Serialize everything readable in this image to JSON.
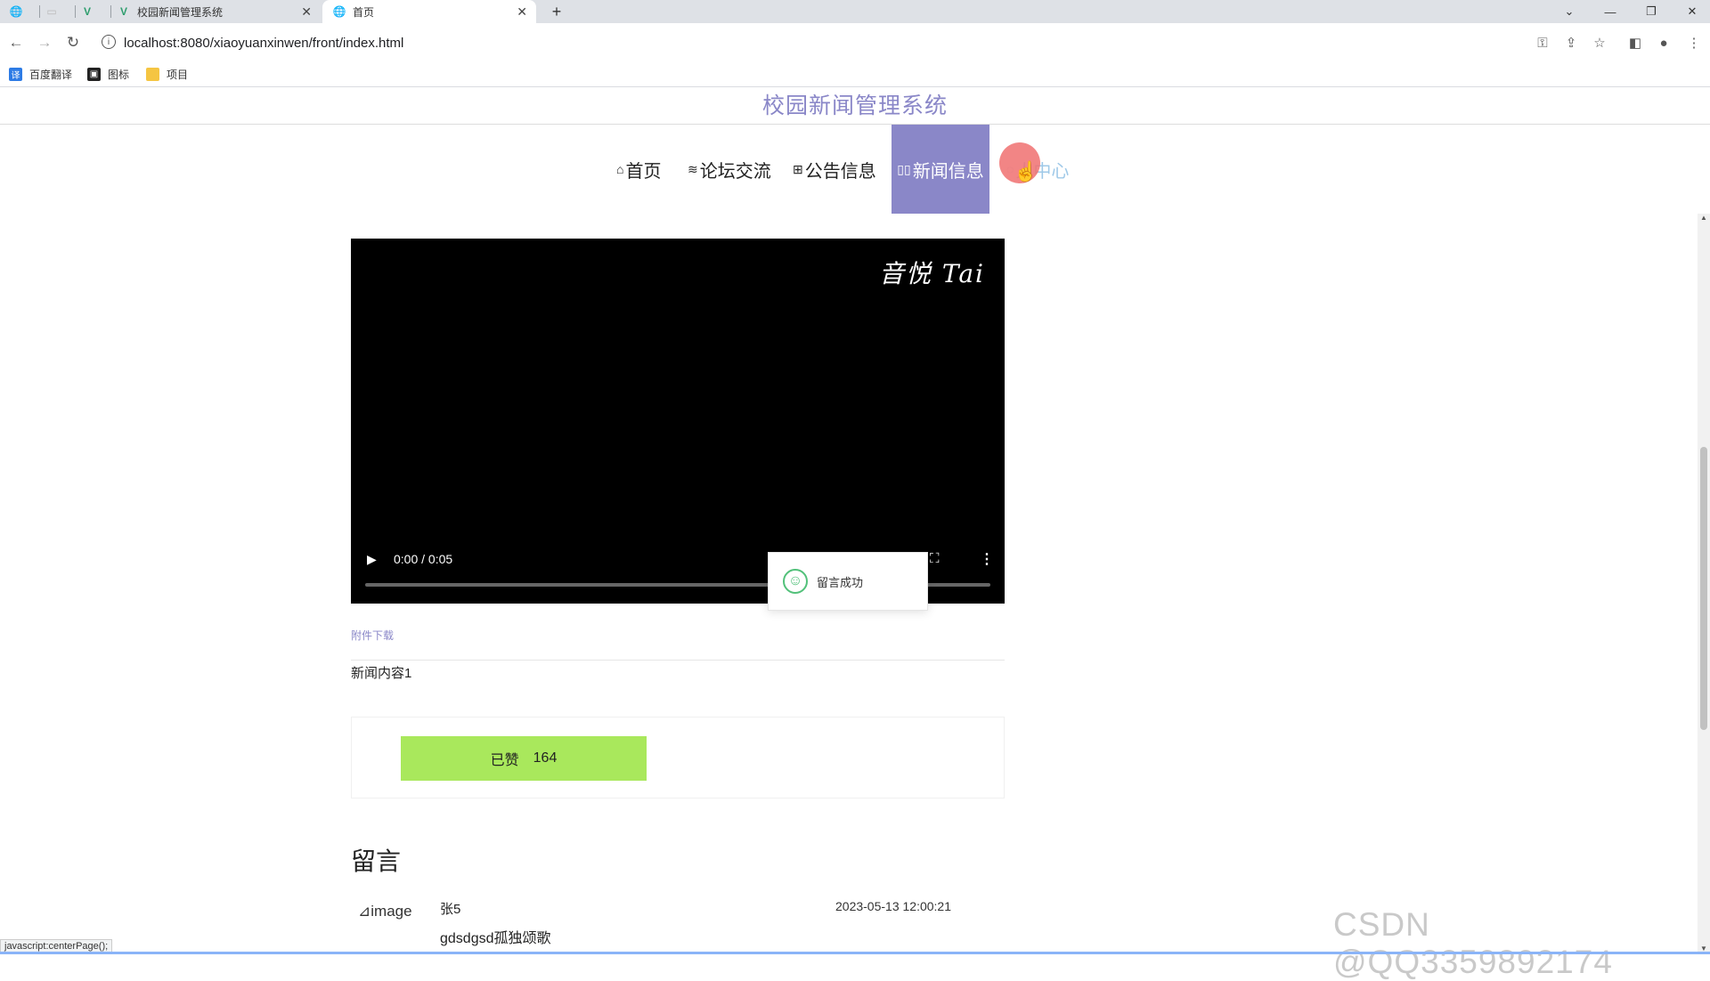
{
  "browser": {
    "tabs": [
      {
        "label": "",
        "icon": "globe-icon"
      },
      {
        "label": "",
        "icon": "blank-tab-icon"
      },
      {
        "label": "",
        "icon": "vue-icon"
      },
      {
        "label": "校园新闻管理系统",
        "icon": "vue-icon"
      },
      {
        "label": "首页",
        "icon": "globe-icon"
      }
    ],
    "url": "localhost:8080/xiaoyuanxinwen/front/index.html",
    "bookmarks": [
      {
        "label": "百度翻译",
        "icon": "translate-icon",
        "color": "#2d7be5"
      },
      {
        "label": "图标",
        "icon": "image-icon",
        "color": "#222222"
      },
      {
        "label": "项目",
        "icon": "folder-icon",
        "color": "#f5c542"
      }
    ]
  },
  "site": {
    "title": "校园新闻管理系统",
    "accent": "#8a87c8"
  },
  "nav": {
    "items": [
      {
        "label": "首页",
        "icon": "home-icon"
      },
      {
        "label": "论坛交流",
        "icon": "layers-icon"
      },
      {
        "label": "公告信息",
        "icon": "grid-icon"
      },
      {
        "label": "新闻信息",
        "icon": "news-icon"
      },
      {
        "label": "人中心",
        "icon": "user-icon"
      }
    ],
    "active_index": 3
  },
  "video": {
    "logo": "音悦 Tai",
    "time": "0:00 / 0:05",
    "progress": 0
  },
  "toast": {
    "text": "留言成功"
  },
  "article": {
    "attachment_label": "附件下载",
    "content": "新闻内容1"
  },
  "like": {
    "label": "已赞",
    "count": "164",
    "color": "#a9e85c"
  },
  "comments": {
    "title": "留言",
    "items": [
      {
        "image_alt": "image",
        "user": "张5",
        "time": "2023-05-13 12:00:21",
        "text": "gdsdgsd孤独颂歌"
      }
    ]
  },
  "watermark": "CSDN @QQ3359892174",
  "status_text": "javascript:centerPage();"
}
